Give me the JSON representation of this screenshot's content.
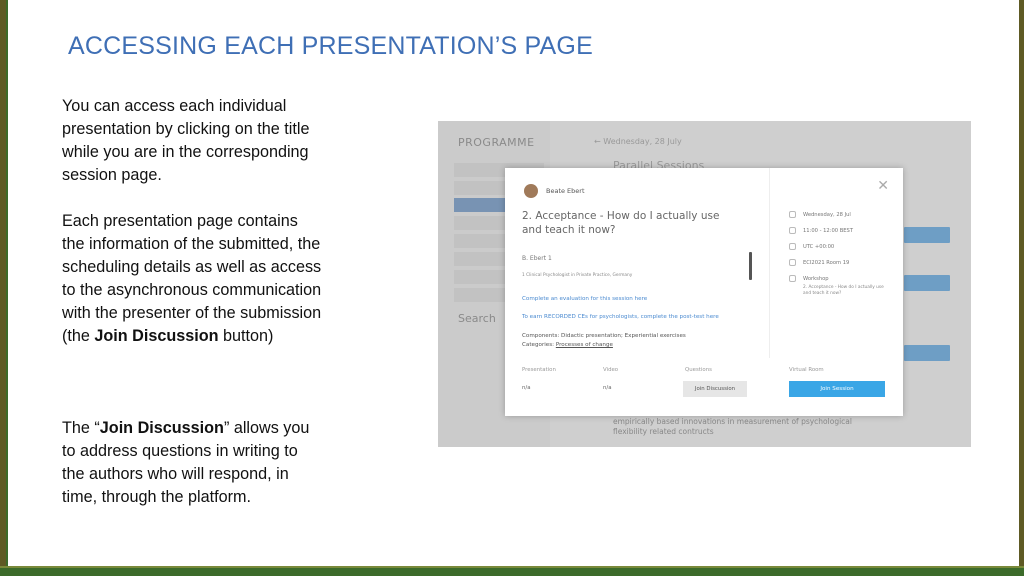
{
  "title": "ACCESSING EACH PRESENTATION’S PAGE",
  "paragraph1": "You can access each individual presentation by clicking on the title while you are in the corresponding session page.",
  "paragraph2": {
    "part1": "Each presentation page contains the information of the submitted, the scheduling details as well as access to the asynchronous communication with the presenter of the submission (the ",
    "bold": "Join Discussion",
    "part2": " button)"
  },
  "paragraph3": {
    "part1": "The “",
    "bold": "Join Discussion",
    "part2": "” allows you to address questions in writing to the authors who will respond, in time, through the platform."
  },
  "screenshot": {
    "background": {
      "programme_label": "PROGRAMME",
      "date_label": "←  Wednesday, 28 July",
      "parallel_label": "Parallel Sessions",
      "search_label": "Search",
      "lower_text": "empirically based innovations in measurement of psychological flexibility related contructs"
    },
    "modal": {
      "author": "Beate Ebert",
      "presentation_title": "2. Acceptance - How do I actually use and teach it now?",
      "author_line": "B. Ebert 1",
      "affiliation": "1 Clinical Psychologist in Private Practice, Germany",
      "link1": "Complete an evaluation for this session here",
      "link2": "To earn RECORDED CEs for psychologists, complete the post-test here",
      "components": "Components: Didactic presentation; Experiential exercises",
      "categories_label": "Categories: ",
      "categories_value": "Processes of change",
      "headers": {
        "presentation": "Presentation",
        "video": "Video",
        "questions": "Questions",
        "virtual_room": "Virtual Room"
      },
      "values": {
        "presentation": "n/a",
        "video": "n/a"
      },
      "join_discussion": "Join Discussion",
      "join_session": "Join Session",
      "info": {
        "date": "Wednesday, 28 Jul",
        "time": "11:00 - 12:00 BEST",
        "timezone": "UTC +00:00",
        "room": "ECI2021 Room 19",
        "type": "Workshop",
        "talk": "2. Acceptance - How do I actually use and teach it now?"
      }
    }
  },
  "colors": {
    "title": "#3f6fb5",
    "frame_olive": "#5e5a24",
    "frame_green": "#3c6b2a",
    "join_session_button": "#3aa6e6"
  }
}
